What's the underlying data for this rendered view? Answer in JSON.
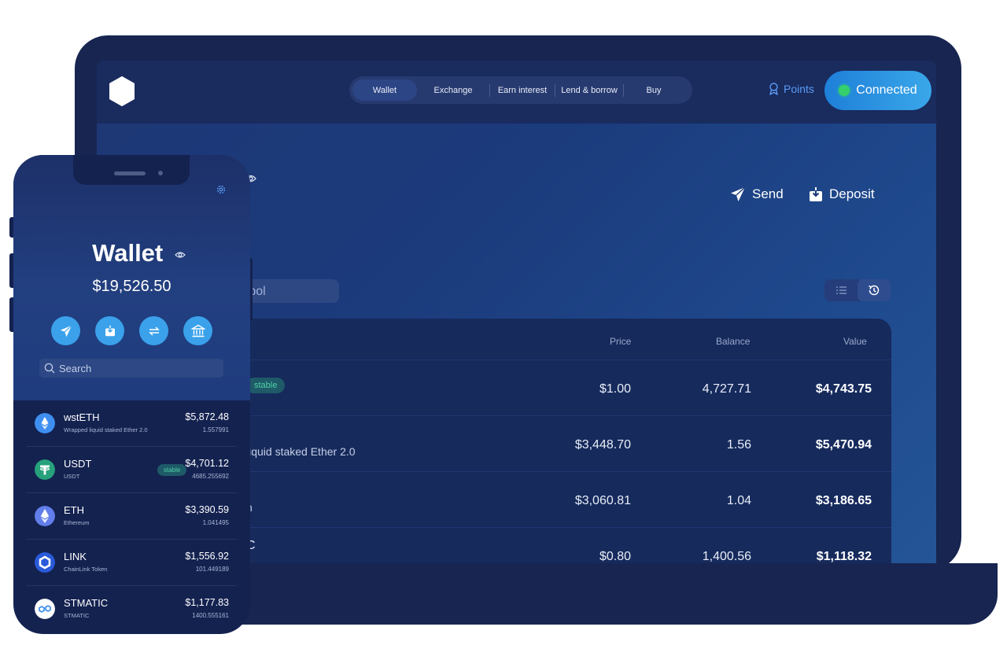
{
  "desktop": {
    "nav": [
      "Wallet",
      "Exchange",
      "Earn interest",
      "Lend & borrow",
      "Buy"
    ],
    "points_label": "Points",
    "connected_label": "Connected",
    "send_label": "Send",
    "deposit_label": "Deposit",
    "search_partial": "mbol",
    "table_headers": {
      "price": "Price",
      "balance": "Balance",
      "value": "Value"
    },
    "rows": [
      {
        "badge": "stable",
        "subtitle": "",
        "price": "$1.00",
        "balance": "4,727.71",
        "value": "$4,743.75"
      },
      {
        "badge": "",
        "subtitle": " liquid staked Ether 2.0",
        "price": "$3,448.70",
        "balance": "1.56",
        "value": "$5,470.94"
      },
      {
        "badge": "",
        "subtitle": "n",
        "price": "$3,060.81",
        "balance": "1.04",
        "value": "$3,186.65"
      },
      {
        "badge": "",
        "subtitle": "C",
        "price": "$0.80",
        "balance": "1,400.56",
        "value": "$1,118.32"
      }
    ]
  },
  "phone": {
    "title": "Wallet",
    "balance": "$19,526.50",
    "search_placeholder": "Search",
    "tokens": [
      {
        "symbol": "wstETH",
        "name": "Wrapped liquid staked Ether 2.0",
        "value": "$5,872.48",
        "amount": "1.557991",
        "badge": "",
        "icon": "wsteth-icon"
      },
      {
        "symbol": "USDT",
        "name": "USDT",
        "value": "$4,701.12",
        "amount": "4685.255692",
        "badge": "stable",
        "icon": "usdt-icon"
      },
      {
        "symbol": "ETH",
        "name": "Ethereum",
        "value": "$3,390.59",
        "amount": "1.041495",
        "badge": "",
        "icon": "eth-icon"
      },
      {
        "symbol": "LINK",
        "name": "ChainLink Token",
        "value": "$1,556.92",
        "amount": "101.449189",
        "badge": "",
        "icon": "link-icon"
      },
      {
        "symbol": "STMATIC",
        "name": "STMATIC",
        "value": "$1,177.83",
        "amount": "1400.555161",
        "badge": "",
        "icon": "stmatic-icon"
      }
    ]
  },
  "colors": {
    "accent": "#3aa1ea",
    "connected_dot": "#35d06b",
    "stable_badge_text": "#4fd1a4",
    "device_frame": "#172550"
  }
}
